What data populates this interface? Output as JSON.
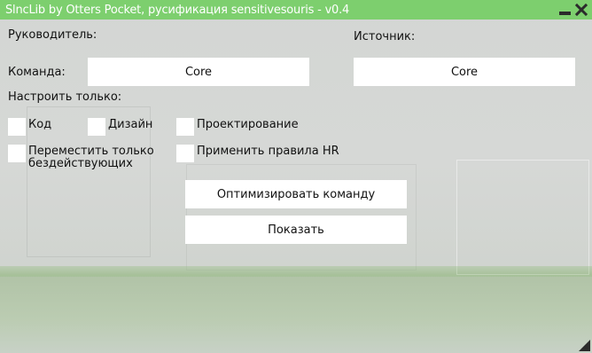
{
  "window": {
    "title": "SlncLib by Otters Pocket, русификация sensitivesouris - v0.4",
    "accent_color": "#7dcf6e",
    "minimize_icon": "minimize-icon",
    "close_icon": "close-icon"
  },
  "fields": {
    "leader_label": "Руководитель:",
    "source_label": "Источник:",
    "team_label": "Команда:",
    "team_value": "Core",
    "source_value": "Core",
    "configure_only_label": "Настроить только:"
  },
  "checkboxes": [
    {
      "label": "Код",
      "checked": false
    },
    {
      "label": "Дизайн",
      "checked": false
    },
    {
      "label": "Проектирование",
      "checked": false
    },
    {
      "label": "Переместить только бездействующих",
      "checked": false
    },
    {
      "label": "Применить правила HR",
      "checked": false
    }
  ],
  "actions": {
    "optimize_label": "Оптимизировать команду",
    "show_label": "Показать"
  }
}
